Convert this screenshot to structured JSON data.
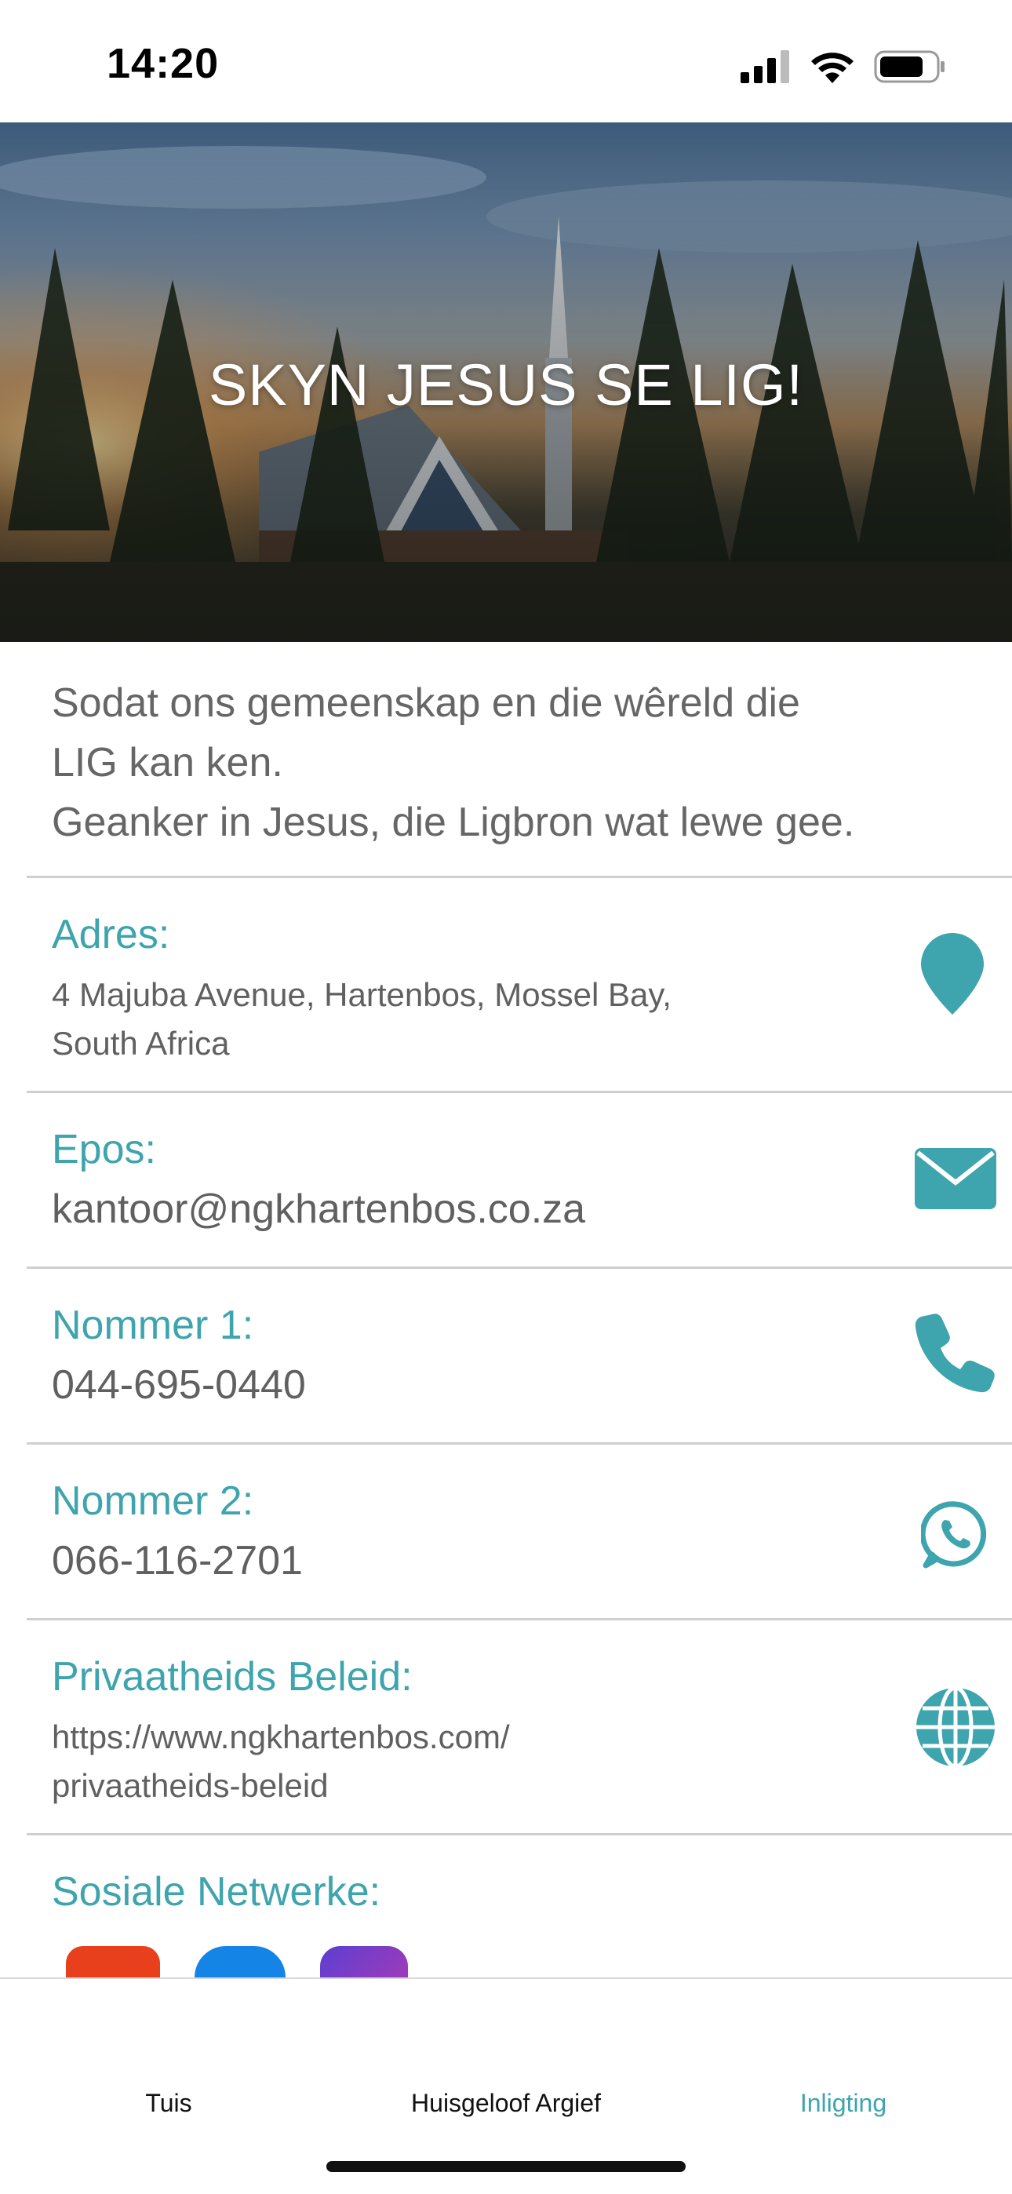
{
  "status_bar": {
    "time": "14:20"
  },
  "hero": {
    "title": "SKYN JESUS SE LIG!"
  },
  "tagline": {
    "line1": "Sodat ons gemeenskap en die wêreld die",
    "line2": "LIG kan ken.",
    "line3": "Geanker in Jesus, die Ligbron wat lewe gee."
  },
  "contact": {
    "address": {
      "label": "Adres:",
      "value_line1": "4 Majuba Avenue, Hartenbos, Mossel Bay,",
      "value_line2": "South Africa",
      "icon": "map-pin-icon"
    },
    "email": {
      "label": "Epos:",
      "value": "kantoor@ngkhartenbos.co.za",
      "icon": "envelope-icon"
    },
    "phone1": {
      "label": "Nommer 1:",
      "value": "044-695-0440",
      "icon": "phone-icon"
    },
    "phone2": {
      "label": "Nommer 2:",
      "value": "066-116-2701",
      "icon": "whatsapp-icon"
    },
    "privacy": {
      "label": "Privaatheids Beleid:",
      "value_line1": "https://www.ngkhartenbos.com/",
      "value_line2": "privaatheids-beleid",
      "icon": "globe-icon"
    },
    "social": {
      "label": "Sosiale Netwerke:"
    }
  },
  "colors": {
    "accent": "#3ea4ad",
    "text": "#606060",
    "divider": "#cfcfcf"
  },
  "tab_bar": {
    "tabs": [
      {
        "label": "Tuis",
        "active": false
      },
      {
        "label": "Huisgeloof Argief",
        "active": false
      },
      {
        "label": "Inligting",
        "active": true
      }
    ]
  }
}
